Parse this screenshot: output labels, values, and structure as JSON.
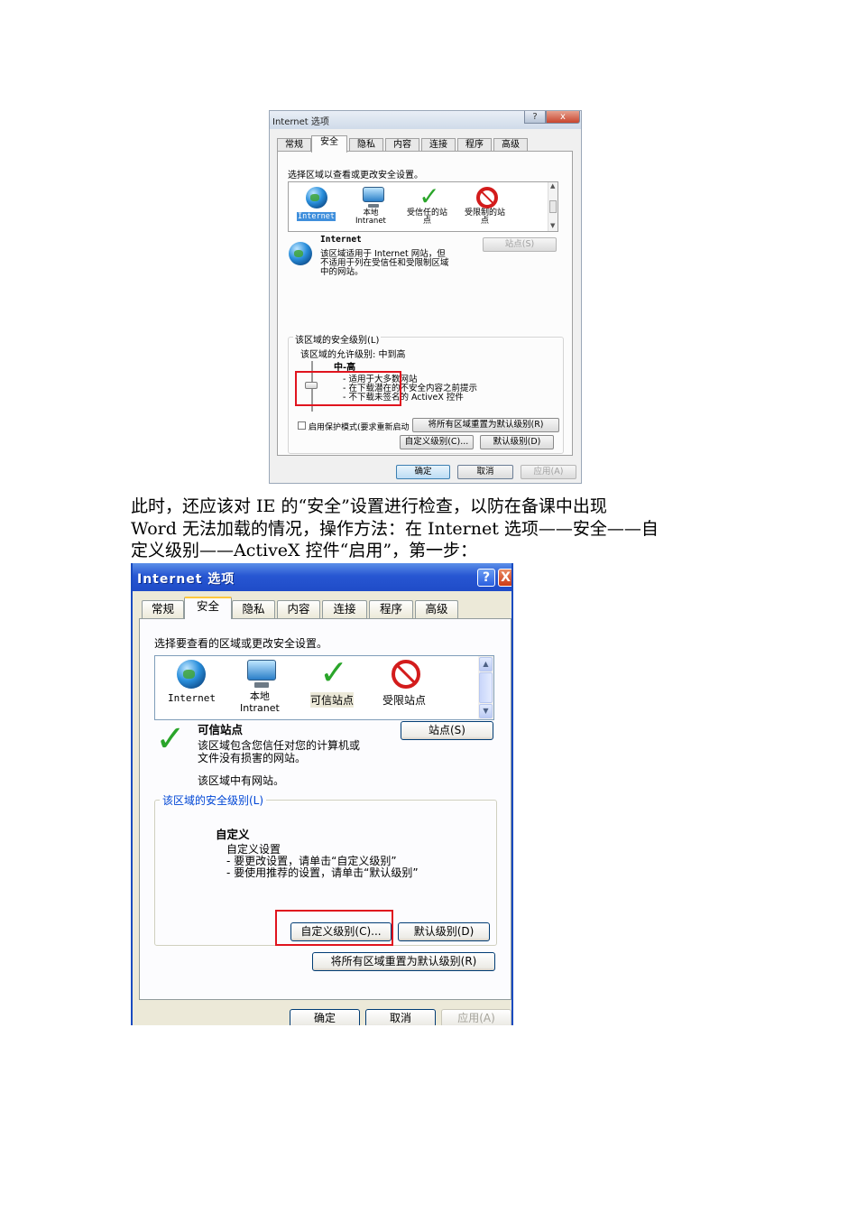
{
  "dialog1": {
    "title": "Internet 选项",
    "help_glyph": "?",
    "close_glyph": "x",
    "tabs": [
      "常规",
      "安全",
      "隐私",
      "内容",
      "连接",
      "程序",
      "高级"
    ],
    "zone_prompt": "选择区域以查看或更改安全设置。",
    "zones": [
      {
        "label": "Internet",
        "icon": "globe-icon"
      },
      {
        "label": "本地\nIntranet",
        "icon": "computer-icon"
      },
      {
        "label": "受信任的站\n点",
        "icon": "check-icon"
      },
      {
        "label": "受限制的站\n点",
        "icon": "no-entry-icon"
      }
    ],
    "selected_zone_title": "Internet",
    "sites_button": "站点(S)",
    "zone_description": "该区域适用于 Internet 网站，但\n不适用于列在受信任和受限制区域\n中的网站。",
    "security_level_group": "该区域的安全级别(L)",
    "allowed_levels": "该区域的允许级别: 中到高",
    "level_name": "中-高",
    "level_points": [
      "- 适用于大多数网站",
      "- 在下载潜在的不安全内容之前提示",
      "- 不下载未签名的 ActiveX 控件"
    ],
    "protected_mode": "启用保护模式(要求重新启动 Internet Explorer)(P)",
    "custom_level_button": "自定义级别(C)...",
    "default_level_button": "默认级别(D)",
    "reset_all_button": "将所有区域重置为默认级别(R)",
    "ok_button": "确定",
    "cancel_button": "取消",
    "apply_button": "应用(A)"
  },
  "paragraph": {
    "lines": [
      "此时，还应该对 IE 的“安全”设置进行检查，以防在备课中出现",
      "Word 无法加载的情况，操作方法：在 Internet 选项——安全——自",
      "定义级别——ActiveX 控件“启用”，第一步："
    ]
  },
  "dialog2": {
    "title": "Internet 选项",
    "help_glyph": "?",
    "close_glyph": "X",
    "tabs": [
      "常规",
      "安全",
      "隐私",
      "内容",
      "连接",
      "程序",
      "高级"
    ],
    "zone_prompt": "选择要查看的区域或更改安全设置。",
    "zones": [
      {
        "label": "Internet",
        "icon": "globe-icon"
      },
      {
        "label": "本地\nIntranet",
        "icon": "computer-icon"
      },
      {
        "label": "可信站点",
        "icon": "check-icon"
      },
      {
        "label": "受限站点",
        "icon": "no-entry-icon"
      }
    ],
    "selected_zone_title": "可信站点",
    "sites_button": "站点(S)",
    "zone_description": "该区域包含您信任对您的计算机或\n文件没有损害的网站。",
    "zone_has_sites": "该区域中有网站。",
    "security_level_group": "该区域的安全级别(L)",
    "level_name": "自定义",
    "level_points": [
      "自定义设置",
      "- 要更改设置，请单击“自定义级别”",
      "- 要使用推荐的设置，请单击“默认级别”"
    ],
    "custom_level_button": "自定义级别(C)...",
    "default_level_button": "默认级别(D)",
    "reset_all_button": "将所有区域重置为默认级别(R)",
    "ok_button": "确定",
    "cancel_button": "取消",
    "apply_button": "应用(A)"
  },
  "colors": {
    "highlight_red": "#e0141e",
    "xp_title_blue": "#2756d2",
    "xp_link_blue": "#0046d5"
  }
}
